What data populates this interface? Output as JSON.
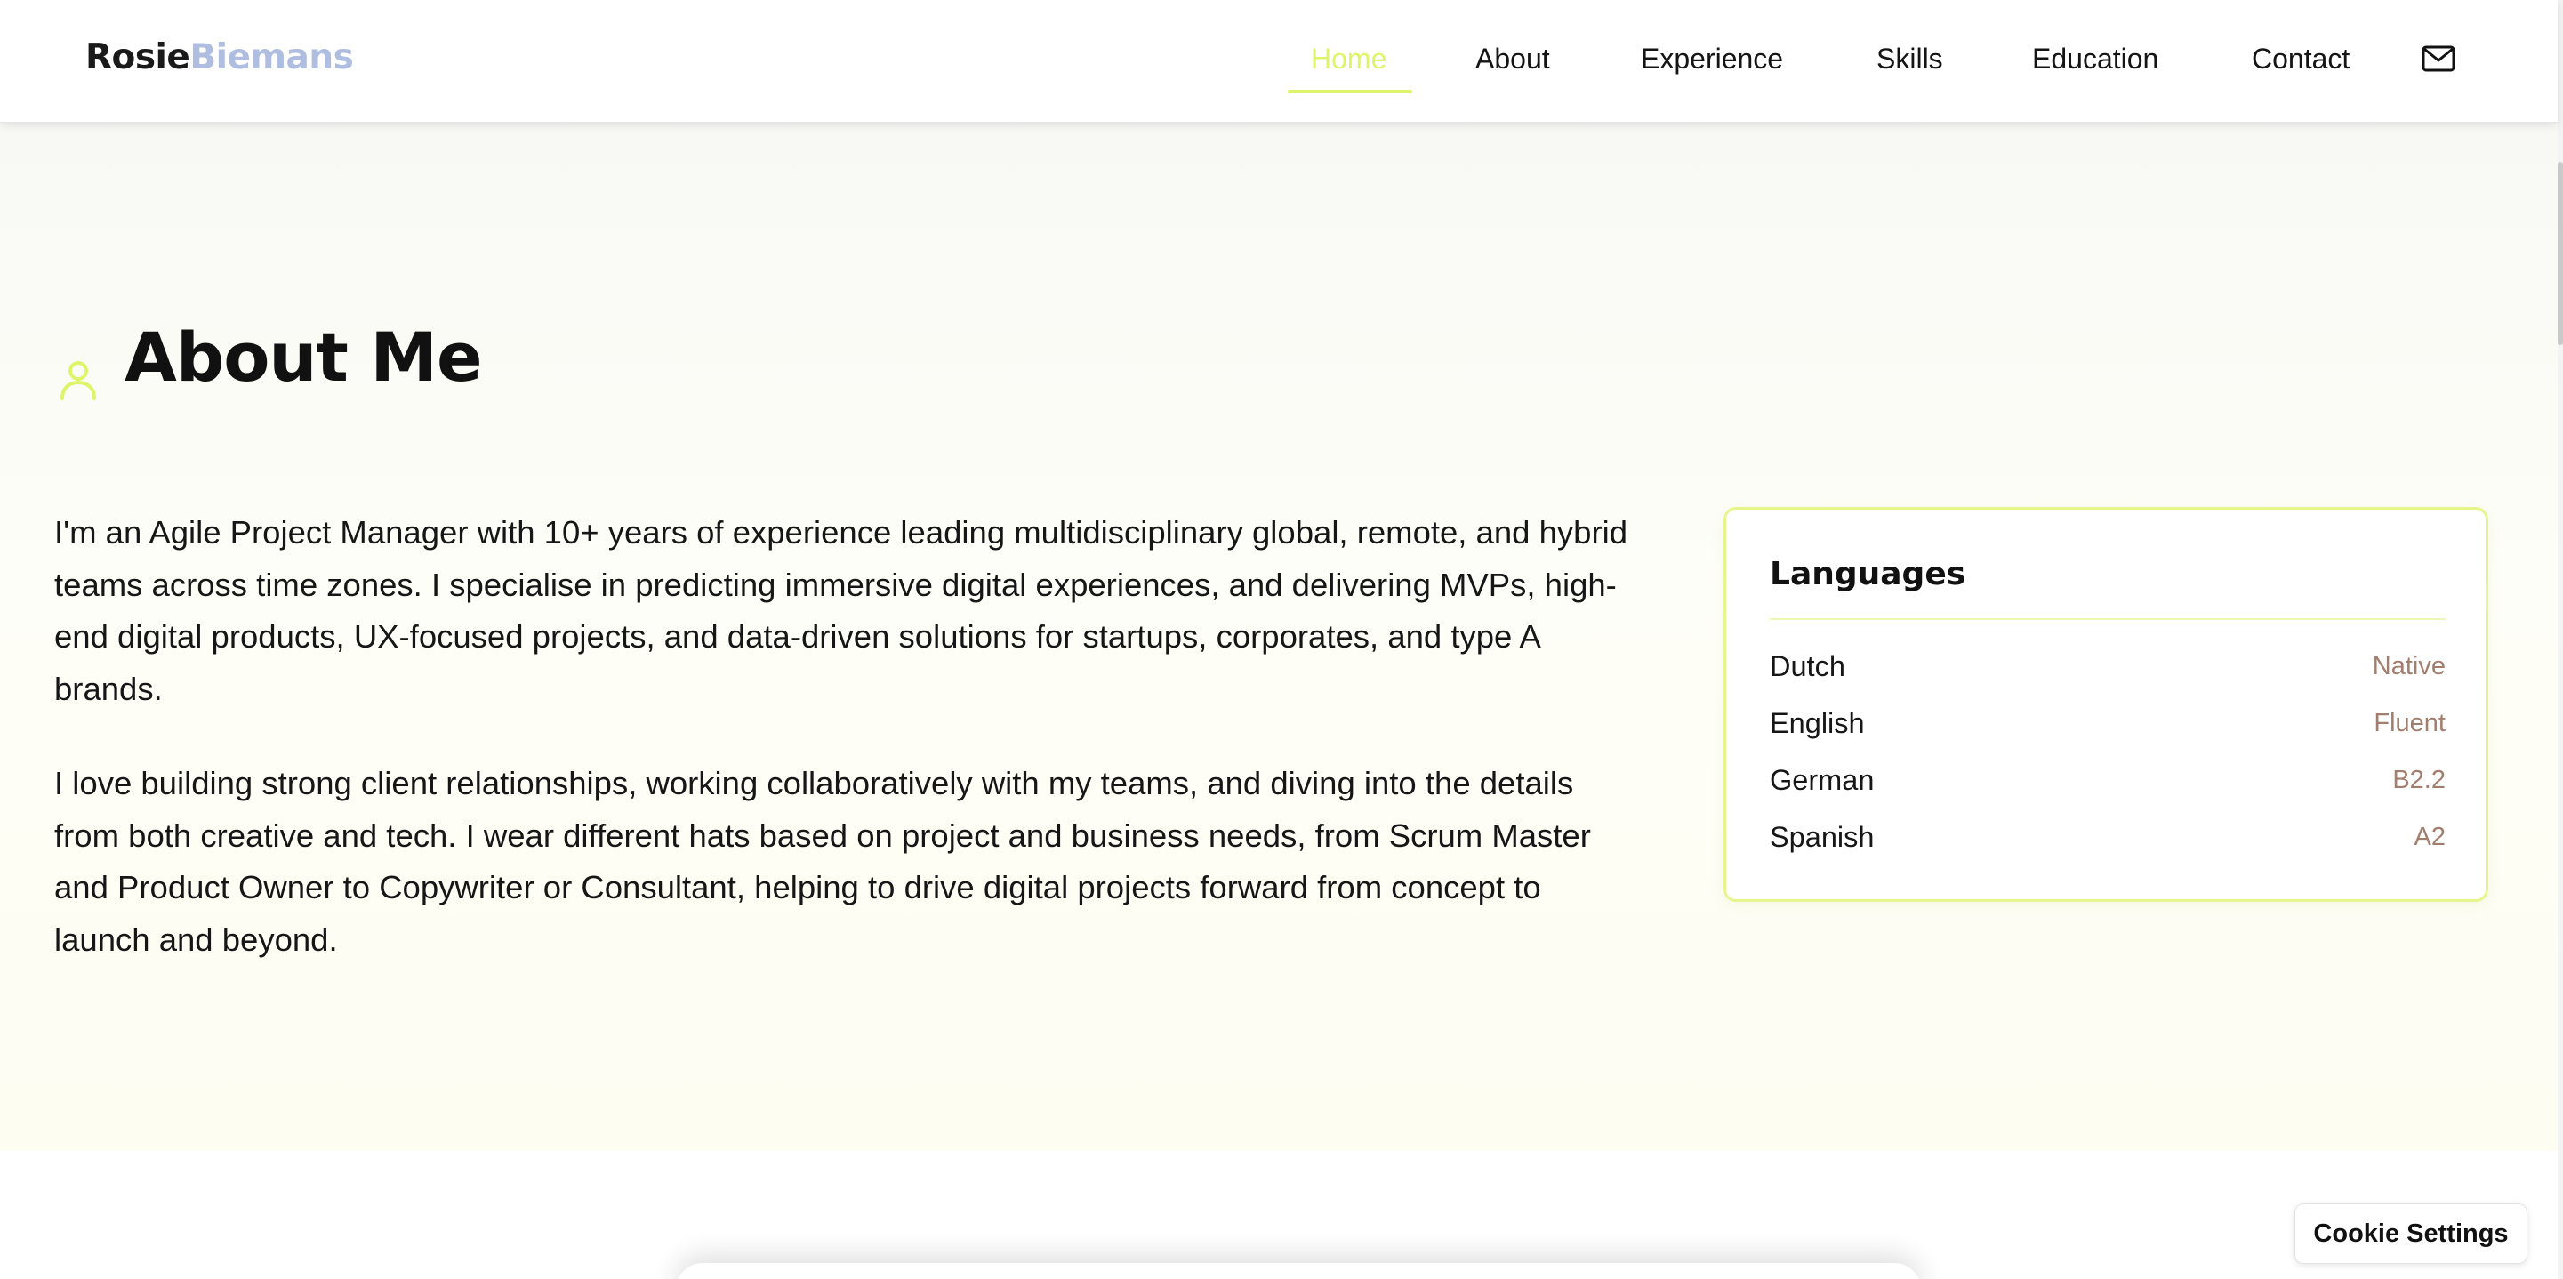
{
  "header": {
    "logo_first": "Rosie",
    "logo_last": "Biemans",
    "nav": {
      "home": "Home",
      "about": "About",
      "experience": "Experience",
      "skills": "Skills",
      "education": "Education",
      "contact": "Contact"
    },
    "active_nav": "home",
    "mail_icon": "mail-icon"
  },
  "about": {
    "title": "About Me",
    "title_icon": "user-icon",
    "paragraphs": [
      "I'm an Agile Project Manager with 10+ years of experience leading multidisciplinary global, remote, and hybrid teams across time zones. I specialise in predicting immersive digital experiences, and delivering MVPs, high-end digital products, UX-focused projects, and data-driven solutions for startups, corporates, and type A brands.",
      "I love building strong client relationships, working collaboratively with my teams, and diving into the details from both creative and tech. I wear different hats based on project and business needs, from Scrum Master and Product Owner to Copywriter or Consultant, helping to drive digital projects forward from concept to launch and beyond."
    ],
    "languages": {
      "title": "Languages",
      "items": [
        {
          "name": "Dutch",
          "level": "Native"
        },
        {
          "name": "English",
          "level": "Fluent"
        },
        {
          "name": "German",
          "level": "B2.2"
        },
        {
          "name": "Spanish",
          "level": "A2"
        }
      ]
    }
  },
  "cookie_settings": "Cookie Settings",
  "colors": {
    "accent": "#dff569",
    "logo_last": "#aebde0",
    "language_level": "#a27e6e",
    "card_border": "#e6f58e"
  }
}
